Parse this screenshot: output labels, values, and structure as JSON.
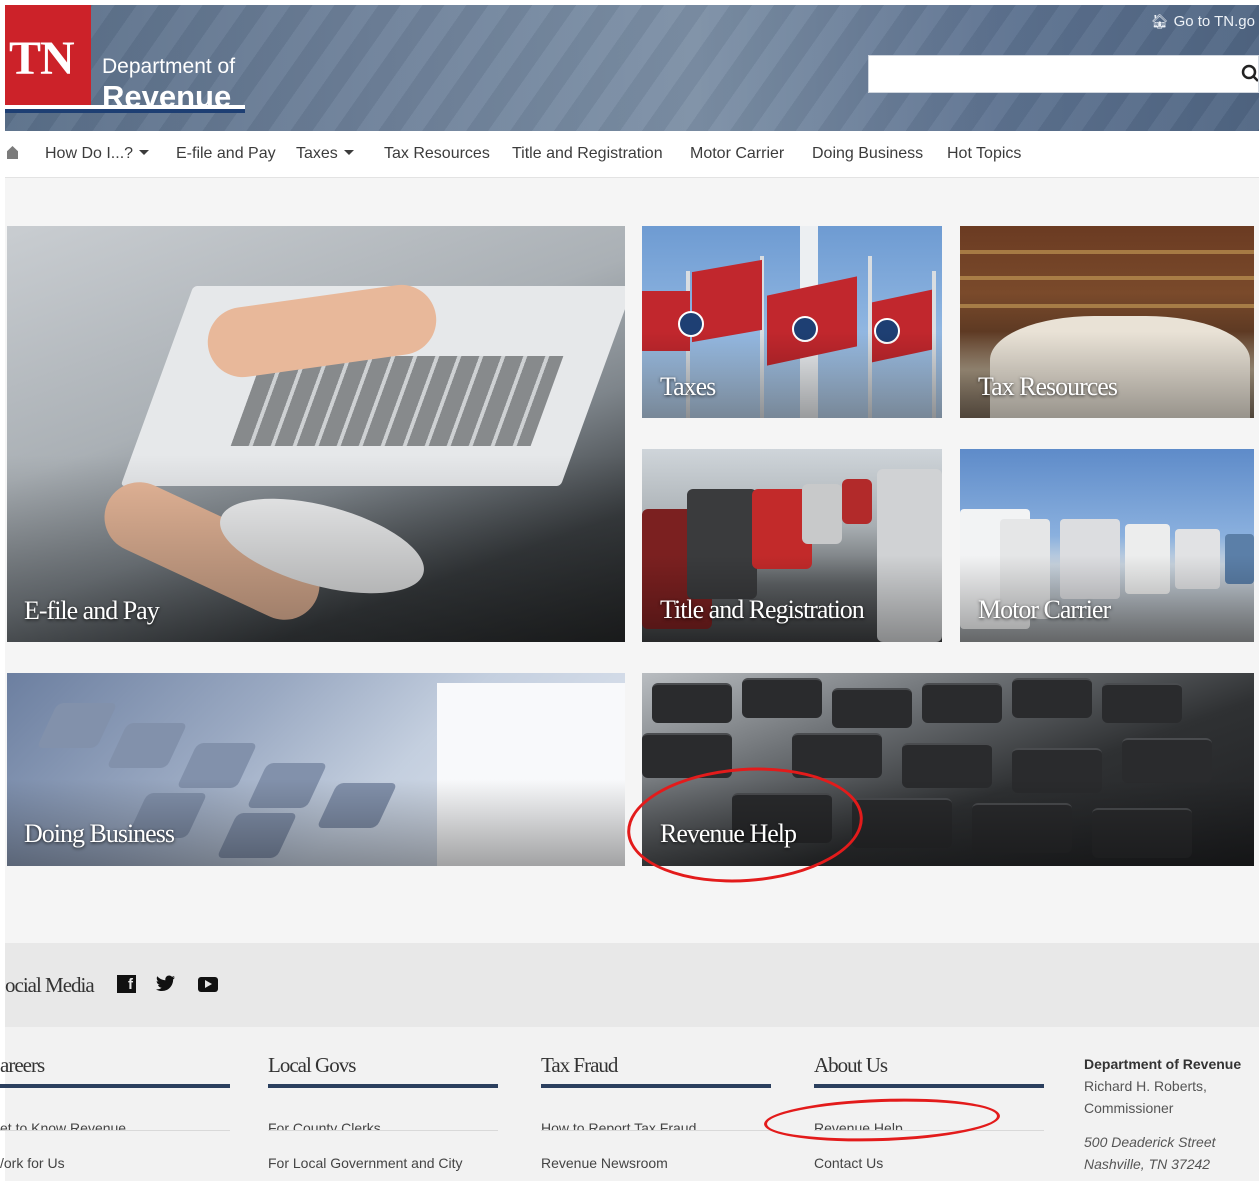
{
  "header": {
    "logo_text": "TN",
    "dept_line1": "Department of",
    "dept_line2": "Revenue",
    "go_link": "Go to TN.go",
    "search_placeholder": ""
  },
  "nav": {
    "items": [
      {
        "label": "How Do I...?",
        "dropdown": true
      },
      {
        "label": "E-file and Pay",
        "dropdown": false
      },
      {
        "label": "Taxes",
        "dropdown": true
      },
      {
        "label": "Tax Resources",
        "dropdown": false
      },
      {
        "label": "Title and Registration",
        "dropdown": false
      },
      {
        "label": "Motor Carrier",
        "dropdown": false
      },
      {
        "label": "Doing Business",
        "dropdown": false
      },
      {
        "label": "Hot Topics",
        "dropdown": false
      }
    ]
  },
  "tiles": {
    "efile": "E-file and Pay",
    "taxes": "Taxes",
    "tax_resources": "Tax Resources",
    "title_registration": "Title and Registration",
    "motor_carrier": "Motor Carrier",
    "doing_business": "Doing Business",
    "revenue_help": "Revenue Help"
  },
  "social": {
    "title": "ocial Media",
    "icons": [
      "facebook-icon",
      "twitter-icon",
      "youtube-icon"
    ]
  },
  "footer": {
    "columns": [
      {
        "title": "areers",
        "links": [
          "et to Know Revenue",
          "/ork for Us"
        ]
      },
      {
        "title": "Local Govs",
        "links": [
          "For County Clerks",
          "For Local Government and City"
        ]
      },
      {
        "title": "Tax Fraud",
        "links": [
          "How to Report Tax Fraud",
          "Revenue Newsroom"
        ]
      },
      {
        "title": "About Us",
        "links": [
          "Revenue Help",
          "Contact Us"
        ]
      }
    ],
    "info": {
      "org": "Department of Revenue",
      "person": "Richard H. Roberts,",
      "role": "Commissioner",
      "street": "500 Deaderick Street",
      "city": "Nashville, TN 37242"
    }
  },
  "colors": {
    "brand_red": "#cc2229",
    "brand_navy": "#1e3f73",
    "annotation_red": "#e31b1b"
  }
}
